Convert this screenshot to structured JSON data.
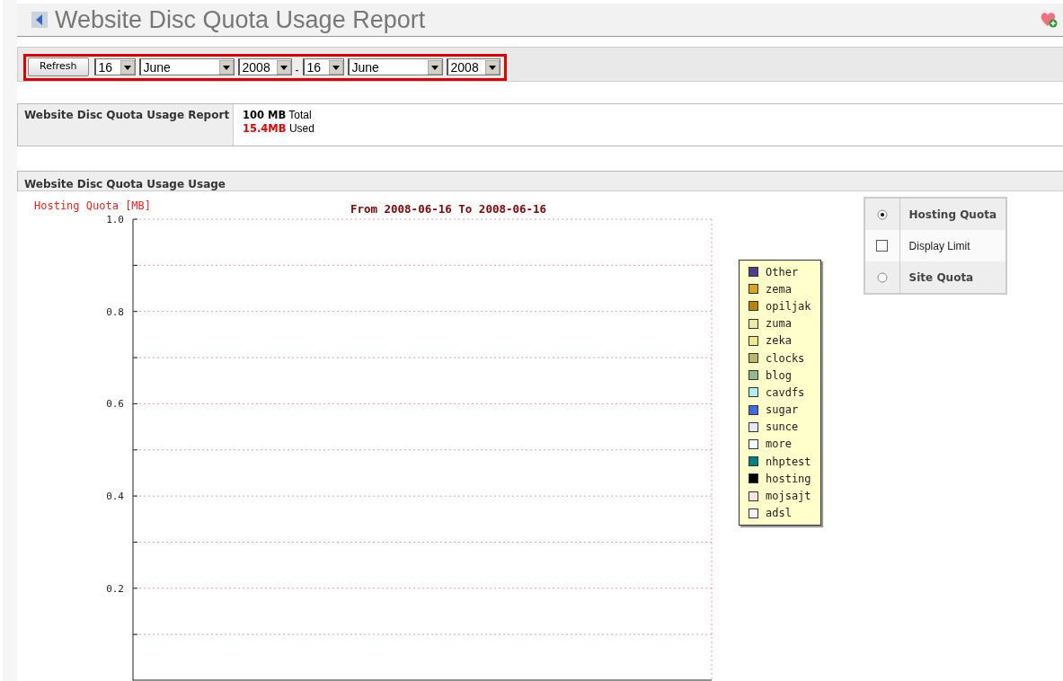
{
  "header": {
    "title": "Website Disc Quota Usage Report"
  },
  "toolbar": {
    "refresh": "Refresh",
    "from": {
      "day": "16",
      "month": "June",
      "year": "2008"
    },
    "separator": "-",
    "to": {
      "day": "16",
      "month": "June",
      "year": "2008"
    }
  },
  "summary": {
    "label": "Website Disc Quota Usage Report",
    "lines": [
      {
        "kind": "total",
        "text": "**100 MB** Total"
      },
      {
        "kind": "used",
        "text": "**15.4MB** Used"
      }
    ]
  },
  "usage": {
    "title": "Website Disc Quota Usage Usage",
    "chart": {
      "title": "From 2008-06-16 To 2008-06-16",
      "ylabel": "Hosting Quota [MB]",
      "y_labels": [
        "1.0",
        "0.8",
        "0.6",
        "0.4",
        "0.2"
      ]
    },
    "legend": [
      {
        "label": "Other",
        "color": "#4b3f8f"
      },
      {
        "label": "zema",
        "color": "#daa520"
      },
      {
        "label": "opiljak",
        "color": "#b8860b"
      },
      {
        "label": "zuma",
        "color": "#eee8aa"
      },
      {
        "label": "zeka",
        "color": "#f0e68c"
      },
      {
        "label": "clocks",
        "color": "#bdb76b"
      },
      {
        "label": "blog",
        "color": "#8fbc8f"
      },
      {
        "label": "cavdfs",
        "color": "#afeeee"
      },
      {
        "label": "sugar",
        "color": "#4169e1"
      },
      {
        "label": "sunce",
        "color": "#e6e6fa"
      },
      {
        "label": "more",
        "color": "#f0ffff"
      },
      {
        "label": "nhptest",
        "color": "#008080"
      },
      {
        "label": "hosting",
        "color": "#000000"
      },
      {
        "label": "mojsajt",
        "color": "#ffe4e1"
      },
      {
        "label": "adsl",
        "color": "#fff0f5"
      }
    ],
    "options": [
      {
        "kind": "radio",
        "label": "Hosting Quota",
        "selected": true
      },
      {
        "kind": "checkbox",
        "label": "Display Limit",
        "checked": false
      },
      {
        "kind": "radio",
        "label": "Site Quota",
        "selected": false
      }
    ]
  }
}
